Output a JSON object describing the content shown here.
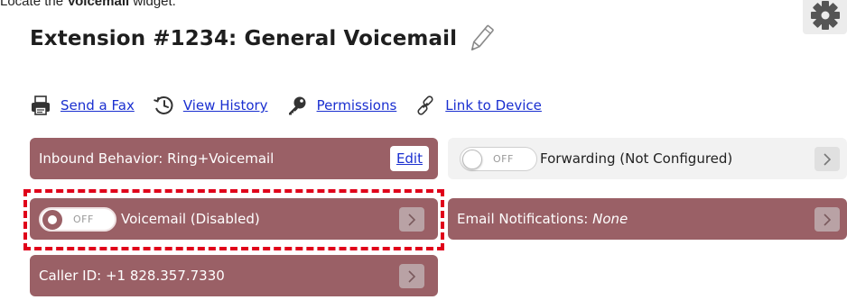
{
  "instruction": {
    "prefix": "Locate the ",
    "target": "Voicemail",
    "suffix": " widget."
  },
  "header": {
    "title": "Extension #1234: General Voicemail"
  },
  "actions": [
    {
      "label": "Send a Fax",
      "icon": "printer-icon"
    },
    {
      "label": "View History",
      "icon": "history-icon"
    },
    {
      "label": "Permissions",
      "icon": "key-icon"
    },
    {
      "label": "Link to Device",
      "icon": "link-icon"
    }
  ],
  "cards": {
    "inbound": {
      "label": "Inbound Behavior: Ring+Voicemail",
      "button": "Edit"
    },
    "voicemail": {
      "label": "Voicemail (Disabled)",
      "toggle": "OFF"
    },
    "caller_id": {
      "label": "Caller ID: +1 828.357.7330"
    },
    "forwarding": {
      "label": "Forwarding (Not Configured)",
      "toggle": "OFF"
    },
    "email": {
      "prefix": "Email Notifications: ",
      "value": "None"
    }
  },
  "colors": {
    "card_dark": "#9a6066",
    "link": "#1a2fd0",
    "highlight": "#e0001a"
  }
}
